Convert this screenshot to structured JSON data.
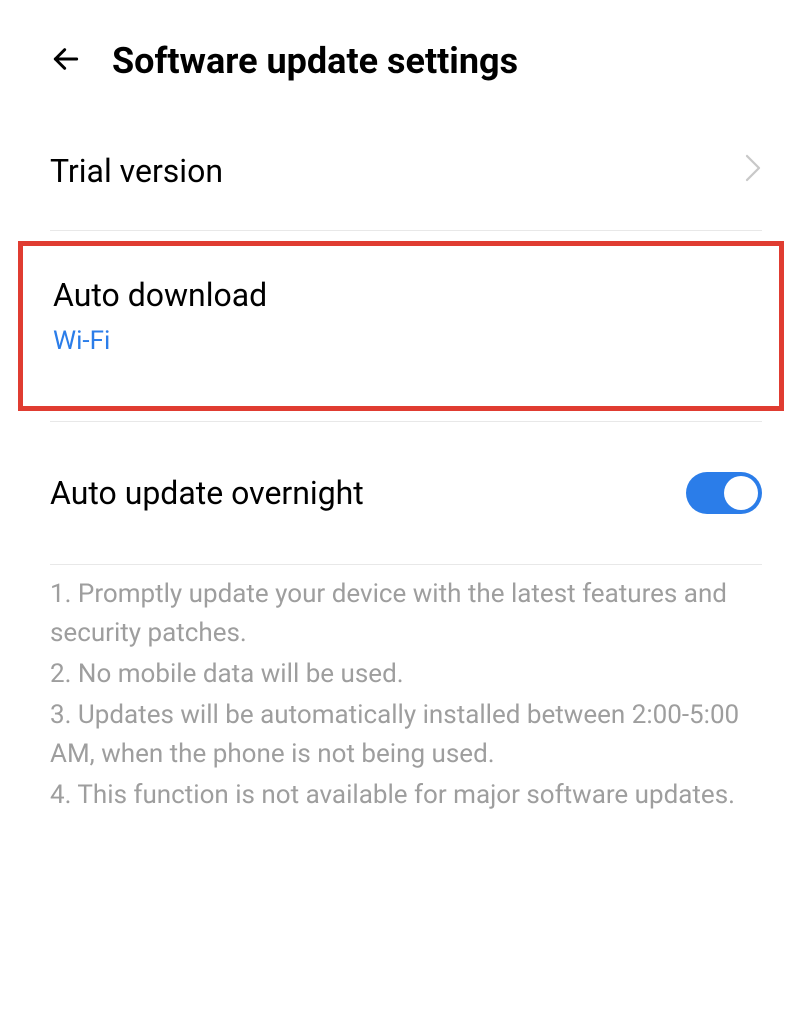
{
  "header": {
    "title": "Software update settings"
  },
  "items": {
    "trial_version": {
      "title": "Trial version"
    },
    "auto_download": {
      "title": "Auto download",
      "subtitle": "Wi-Fi"
    },
    "auto_update": {
      "title": "Auto update overnight",
      "enabled": true
    }
  },
  "notes": {
    "line1": "1. Promptly update your device with the latest features and security patches.",
    "line2": "2. No mobile data will be used.",
    "line3": "3. Updates will be automatically installed between 2:00-5:00 AM, when the phone is not being used.",
    "line4": "4. This function is not available for major software updates."
  }
}
